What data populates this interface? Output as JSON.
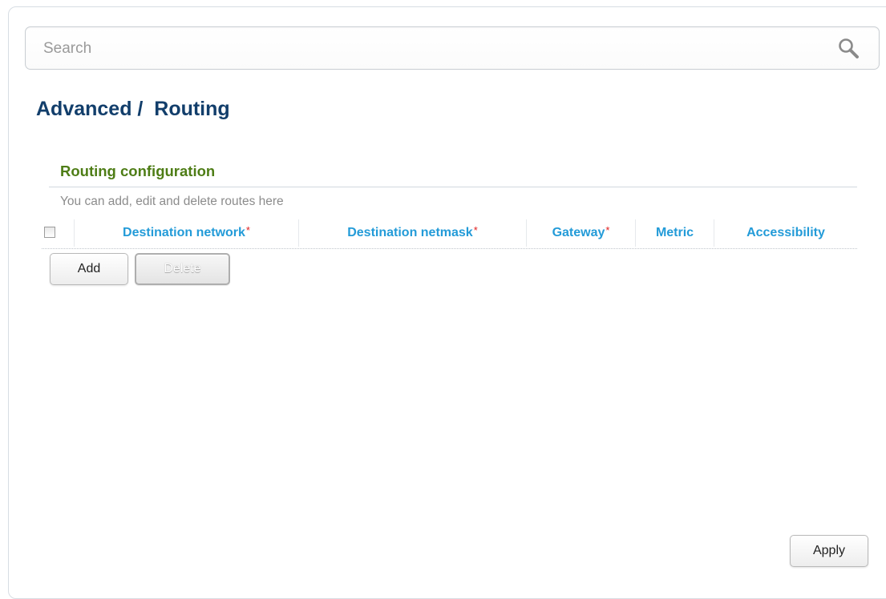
{
  "search": {
    "placeholder": "Search",
    "icon": "search-icon"
  },
  "page": {
    "title": "Advanced /  Routing"
  },
  "section": {
    "title": "Routing configuration",
    "description": "You can add, edit and delete routes here"
  },
  "table": {
    "columns": [
      {
        "label": "Destination network",
        "required_mark": "*"
      },
      {
        "label": "Destination netmask",
        "required_mark": "*"
      },
      {
        "label": "Gateway",
        "required_mark": "*"
      },
      {
        "label": "Metric",
        "required_mark": ""
      },
      {
        "label": "Accessibility",
        "required_mark": ""
      }
    ],
    "rows": []
  },
  "buttons": {
    "add": "Add",
    "delete": "Delete",
    "apply": "Apply"
  },
  "colors": {
    "title": "#123e6b",
    "section_title": "#4e7d16",
    "column_header": "#239bd8",
    "required_mark": "#e02020"
  }
}
